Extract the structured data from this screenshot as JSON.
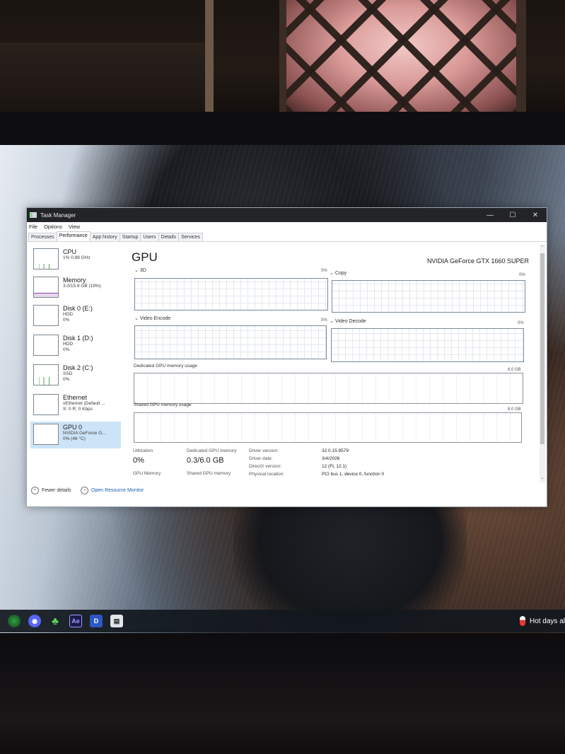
{
  "window": {
    "title": "Task Manager",
    "minimize_glyph": "—",
    "maximize_glyph": "☐",
    "close_glyph": "✕"
  },
  "menu": [
    "File",
    "Options",
    "View"
  ],
  "tabs": [
    "Processes",
    "Performance",
    "App history",
    "Startup",
    "Users",
    "Details",
    "Services"
  ],
  "active_tab": "Performance",
  "sidebar": [
    {
      "title": "CPU",
      "sub1": "1% 0.88 GHz",
      "sub2": ""
    },
    {
      "title": "Memory",
      "sub1": "3.0/15.9 GB (19%)",
      "sub2": ""
    },
    {
      "title": "Disk 0 (E:)",
      "sub1": "HDD",
      "sub2": "0%"
    },
    {
      "title": "Disk 1 (D:)",
      "sub1": "HDD",
      "sub2": "0%"
    },
    {
      "title": "Disk 2 (C:)",
      "sub1": "SSD",
      "sub2": "0%"
    },
    {
      "title": "Ethernet",
      "sub1": "vEthernet (Default ...",
      "sub2": "S: 0 R: 0 Kbps"
    },
    {
      "title": "GPU 0",
      "sub1": "NVIDIA GeForce G...",
      "sub2": "0% (46 °C)"
    }
  ],
  "main": {
    "title": "GPU",
    "model": "NVIDIA GeForce GTX 1660 SUPER",
    "graphs": {
      "g3d": {
        "label": "3D",
        "pct": "0%"
      },
      "copy": {
        "label": "Copy",
        "pct": "0%"
      },
      "encode": {
        "label": "Video Encode",
        "pct": "0%"
      },
      "decode": {
        "label": "Video Decode",
        "pct": "0%"
      }
    },
    "dedicated_label": "Dedicated GPU memory usage",
    "dedicated_max": "6.0 GB",
    "shared_label": "Shared GPU memory usage",
    "shared_max": "8.0 GB"
  },
  "stats": {
    "utilization_label": "Utilization",
    "utilization_value": "0%",
    "gpu_memory_label": "GPU Memory",
    "dedicated_label": "Dedicated GPU memory",
    "dedicated_value": "0.3/6.0 GB",
    "shared_label": "Shared GPU memory",
    "driver_version_key": "Driver version:",
    "driver_version_val": "32.0.15.9579",
    "driver_date_key": "Driver date:",
    "driver_date_val": "3/4/2026",
    "directx_key": "DirectX version:",
    "directx_val": "12 (FL 12.1)",
    "location_key": "Physical location:",
    "location_val": "PCI bus 1, device 0, function 0"
  },
  "footer": {
    "fewer_details": "Fewer details",
    "resource_monitor": "Open Resource Monitor"
  },
  "taskbar": {
    "ae_label": "Ae",
    "d_label": "D",
    "weather_text": "Hot days al"
  },
  "colors": {
    "selected_bg": "#cce4f7",
    "link": "#1d5fb4",
    "titlebar": "#232428"
  }
}
